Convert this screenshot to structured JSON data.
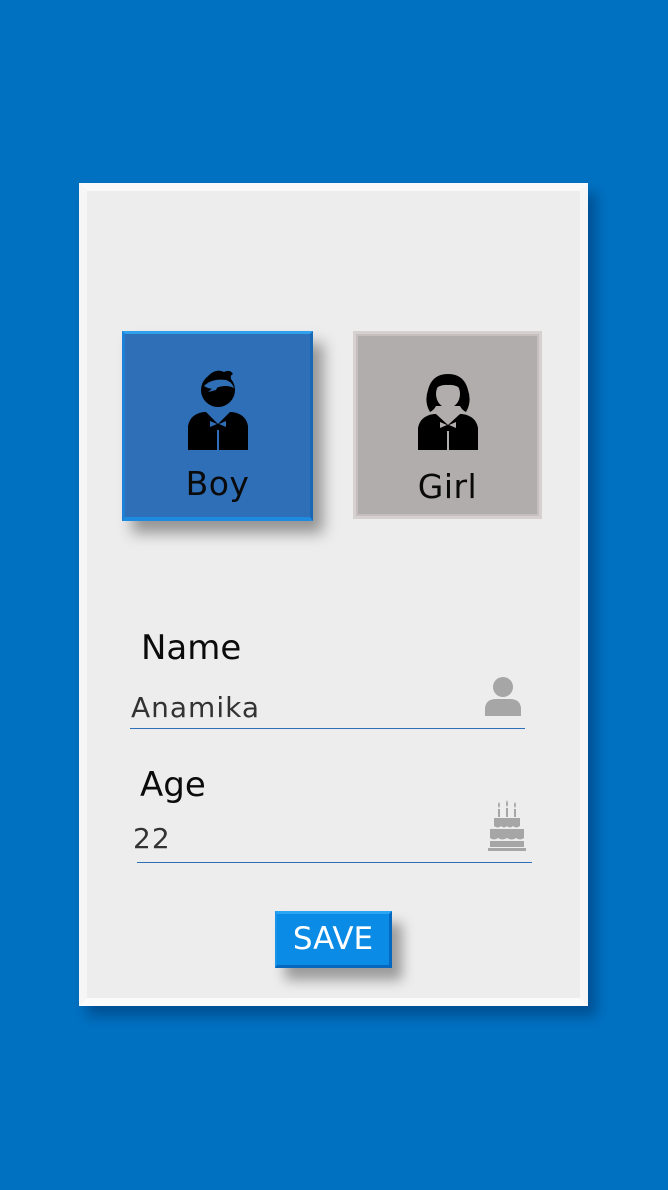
{
  "colors": {
    "background": "#0071c1",
    "card": "#eeedee",
    "boy_selected": "#2f6fb7",
    "girl_unselected": "#b1adac",
    "save_button": "#0a8be6",
    "underline": "#2f6fb7",
    "field_icon": "#a6a6a6"
  },
  "gender": {
    "boy": {
      "label": "Boy",
      "icon": "boy-avatar-icon",
      "selected": true
    },
    "girl": {
      "label": "Girl",
      "icon": "girl-avatar-icon",
      "selected": false
    }
  },
  "form": {
    "name": {
      "label": "Name",
      "value": "Anamika",
      "icon": "person-icon"
    },
    "age": {
      "label": "Age",
      "value": "22",
      "icon": "birthday-cake-icon"
    }
  },
  "actions": {
    "save_label": "SAVE"
  }
}
